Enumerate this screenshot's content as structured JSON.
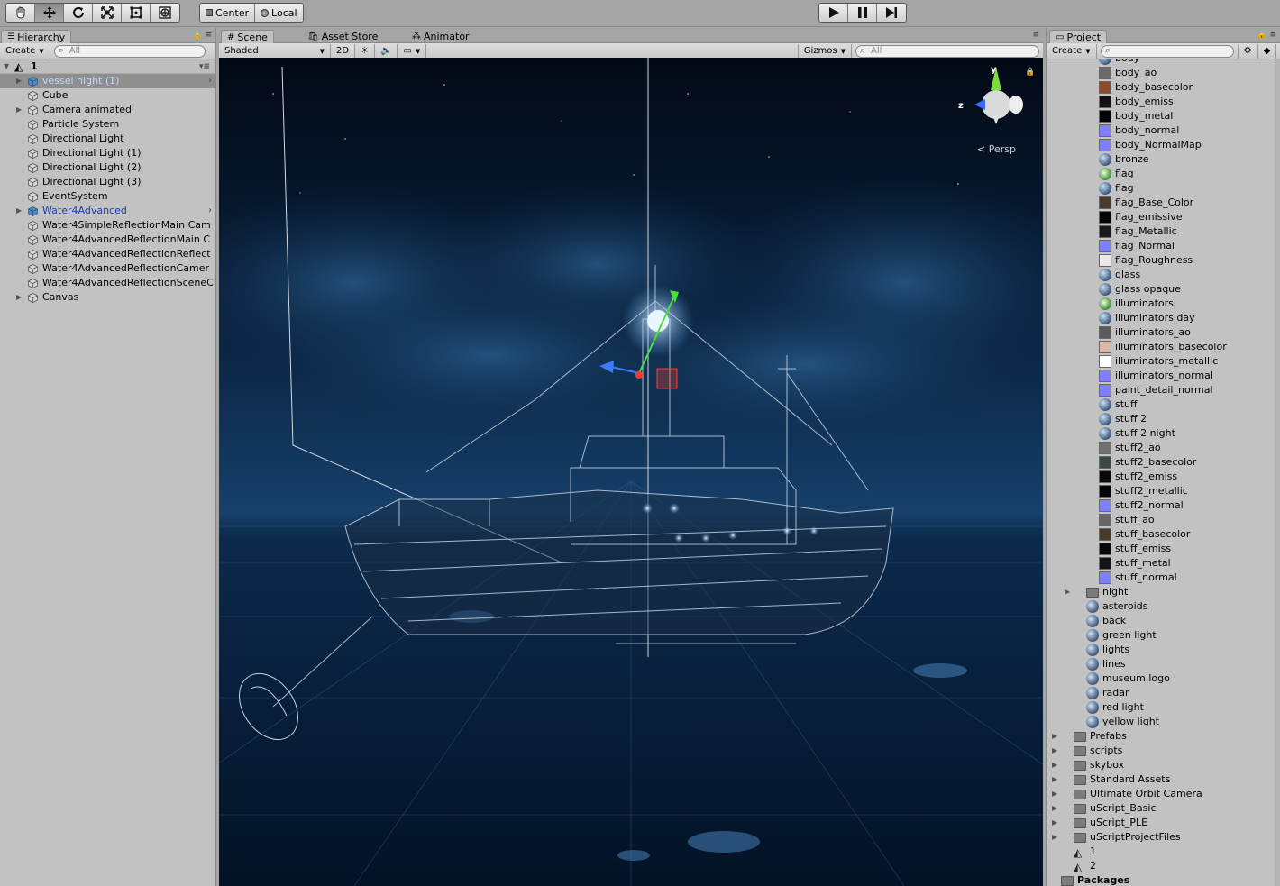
{
  "toolbar": {
    "transform_tools": [
      "hand-tool-icon",
      "move-tool-icon",
      "rotate-tool-icon",
      "scale-tool-icon",
      "rect-tool-icon",
      "transform-tool-icon"
    ],
    "pivot_mode": "Center",
    "pivot_rotation": "Local",
    "play_controls": [
      "play-icon",
      "pause-icon",
      "step-icon"
    ]
  },
  "hierarchy": {
    "tab_label": "Hierarchy",
    "create_label": "Create",
    "search_placeholder": "All",
    "scene_name": "1",
    "items": [
      {
        "label": "vessel night (1)",
        "style": "selected",
        "expandable": true
      },
      {
        "label": "Cube",
        "style": "normal",
        "expandable": false
      },
      {
        "label": "Camera animated",
        "style": "normal",
        "expandable": true
      },
      {
        "label": "Particle System",
        "style": "normal",
        "expandable": false
      },
      {
        "label": "Directional Light",
        "style": "normal",
        "expandable": false
      },
      {
        "label": "Directional Light (1)",
        "style": "normal",
        "expandable": false
      },
      {
        "label": "Directional Light (2)",
        "style": "normal",
        "expandable": false
      },
      {
        "label": "Directional Light (3)",
        "style": "normal",
        "expandable": false
      },
      {
        "label": "EventSystem",
        "style": "normal",
        "expandable": false
      },
      {
        "label": "Water4Advanced",
        "style": "prefab",
        "expandable": true
      },
      {
        "label": "Water4SimpleReflectionMain Cam",
        "style": "normal",
        "expandable": false
      },
      {
        "label": "Water4AdvancedReflectionMain C",
        "style": "normal",
        "expandable": false
      },
      {
        "label": "Water4AdvancedReflectionReflect",
        "style": "normal",
        "expandable": false
      },
      {
        "label": "Water4AdvancedReflectionCamer",
        "style": "normal",
        "expandable": false
      },
      {
        "label": "Water4AdvancedReflectionSceneC",
        "style": "normal",
        "expandable": false
      },
      {
        "label": "Canvas",
        "style": "normal",
        "expandable": true
      }
    ]
  },
  "scene_tabs": [
    {
      "label": "Scene",
      "active": true
    },
    {
      "label": "Asset Store",
      "active": false
    },
    {
      "label": "Animator",
      "active": false
    }
  ],
  "scene_toolbar": {
    "shading_mode": "Shaded",
    "mode_2d": "2D",
    "gizmos_label": "Gizmos",
    "search_placeholder": "All"
  },
  "scene_view": {
    "projection_label": "Persp",
    "gizmo_axes": {
      "y": "y",
      "z": "z"
    }
  },
  "project": {
    "tab_label": "Project",
    "create_label": "Create",
    "items": [
      {
        "label": "body",
        "icon": "material",
        "indent": 2
      },
      {
        "label": "body_ao",
        "icon": "texture",
        "color": "#6a6a6a",
        "indent": 2
      },
      {
        "label": "body_basecolor",
        "icon": "texture",
        "color": "#8a4a2e",
        "indent": 2
      },
      {
        "label": "body_emiss",
        "icon": "texture",
        "color": "#111111",
        "indent": 2
      },
      {
        "label": "body_metal",
        "icon": "texture",
        "color": "#050505",
        "indent": 2
      },
      {
        "label": "body_normal",
        "icon": "texture",
        "color": "#8080ff",
        "indent": 2
      },
      {
        "label": "body_NormalMap",
        "icon": "texture",
        "color": "#8080ff",
        "indent": 2
      },
      {
        "label": "bronze",
        "icon": "material",
        "indent": 2
      },
      {
        "label": "flag",
        "icon": "shader",
        "indent": 2
      },
      {
        "label": "flag",
        "icon": "material",
        "indent": 2
      },
      {
        "label": "flag_Base_Color",
        "icon": "texture",
        "color": "#4a3a30",
        "indent": 2
      },
      {
        "label": "flag_emissive",
        "icon": "texture",
        "color": "#050505",
        "indent": 2
      },
      {
        "label": "flag_Metallic",
        "icon": "texture",
        "color": "#1a1a1a",
        "indent": 2
      },
      {
        "label": "flag_Normal",
        "icon": "texture",
        "color": "#8080ff",
        "indent": 2
      },
      {
        "label": "flag_Roughness",
        "icon": "texture",
        "color": "#e8e8e8",
        "indent": 2
      },
      {
        "label": "glass",
        "icon": "material",
        "indent": 2
      },
      {
        "label": "glass opaque",
        "icon": "material",
        "indent": 2
      },
      {
        "label": "illuminators",
        "icon": "shader",
        "indent": 2
      },
      {
        "label": "illuminators day",
        "icon": "material",
        "indent": 2
      },
      {
        "label": "illuminators_ao",
        "icon": "texture",
        "color": "#5a5a5a",
        "indent": 2
      },
      {
        "label": "illuminators_basecolor",
        "icon": "texture",
        "color": "#d9b8a8",
        "indent": 2
      },
      {
        "label": "illuminators_metallic",
        "icon": "texture",
        "color": "#ffffff",
        "indent": 2
      },
      {
        "label": "illuminators_normal",
        "icon": "texture",
        "color": "#8080ff",
        "indent": 2
      },
      {
        "label": "paint_detail_normal",
        "icon": "texture",
        "color": "#8080ff",
        "indent": 2
      },
      {
        "label": "stuff",
        "icon": "material",
        "indent": 2
      },
      {
        "label": "stuff 2",
        "icon": "material",
        "indent": 2
      },
      {
        "label": "stuff 2 night",
        "icon": "material",
        "indent": 2
      },
      {
        "label": "stuff2_ao",
        "icon": "texture",
        "color": "#707070",
        "indent": 2
      },
      {
        "label": "stuff2_basecolor",
        "icon": "texture",
        "color": "#3a4a40",
        "indent": 2
      },
      {
        "label": "stuff2_emiss",
        "icon": "texture",
        "color": "#0a0a0a",
        "indent": 2
      },
      {
        "label": "stuff2_metallic",
        "icon": "texture",
        "color": "#050505",
        "indent": 2
      },
      {
        "label": "stuff2_normal",
        "icon": "texture",
        "color": "#8080ff",
        "indent": 2
      },
      {
        "label": "stuff_ao",
        "icon": "texture",
        "color": "#666666",
        "indent": 2
      },
      {
        "label": "stuff_basecolor",
        "icon": "texture",
        "color": "#4a3a2a",
        "indent": 2
      },
      {
        "label": "stuff_emiss",
        "icon": "texture",
        "color": "#0a0a0a",
        "indent": 2
      },
      {
        "label": "stuff_metal",
        "icon": "texture",
        "color": "#151515",
        "indent": 2
      },
      {
        "label": "stuff_normal",
        "icon": "texture",
        "color": "#8080ff",
        "indent": 2
      },
      {
        "label": "night",
        "icon": "folder",
        "indent": 1,
        "expandable": true
      },
      {
        "label": "asteroids",
        "icon": "material",
        "indent": 1
      },
      {
        "label": "back",
        "icon": "material",
        "indent": 1
      },
      {
        "label": "green light",
        "icon": "material",
        "indent": 1
      },
      {
        "label": "lights",
        "icon": "material",
        "indent": 1
      },
      {
        "label": "lines",
        "icon": "material",
        "indent": 1
      },
      {
        "label": "museum logo",
        "icon": "material",
        "indent": 1
      },
      {
        "label": "radar",
        "icon": "material",
        "indent": 1
      },
      {
        "label": "red light",
        "icon": "material",
        "indent": 1
      },
      {
        "label": "yellow light",
        "icon": "material",
        "indent": 1
      },
      {
        "label": "Prefabs",
        "icon": "folder",
        "indent": 0,
        "expandable": true
      },
      {
        "label": "scripts",
        "icon": "folder",
        "indent": 0,
        "expandable": true
      },
      {
        "label": "skybox",
        "icon": "folder",
        "indent": 0,
        "expandable": true
      },
      {
        "label": "Standard Assets",
        "icon": "folder",
        "indent": 0,
        "expandable": true
      },
      {
        "label": "Ultimate Orbit Camera",
        "icon": "folder",
        "indent": 0,
        "expandable": true
      },
      {
        "label": "uScript_Basic",
        "icon": "folder",
        "indent": 0,
        "expandable": true
      },
      {
        "label": "uScript_PLE",
        "icon": "folder",
        "indent": 0,
        "expandable": true
      },
      {
        "label": "uScriptProjectFiles",
        "icon": "folder",
        "indent": 0,
        "expandable": true
      },
      {
        "label": "1",
        "icon": "scene",
        "indent": 0
      },
      {
        "label": "2",
        "icon": "scene",
        "indent": 0
      },
      {
        "label": "Packages",
        "icon": "folder",
        "indent": -1,
        "expandable": true,
        "bold": true
      }
    ]
  }
}
